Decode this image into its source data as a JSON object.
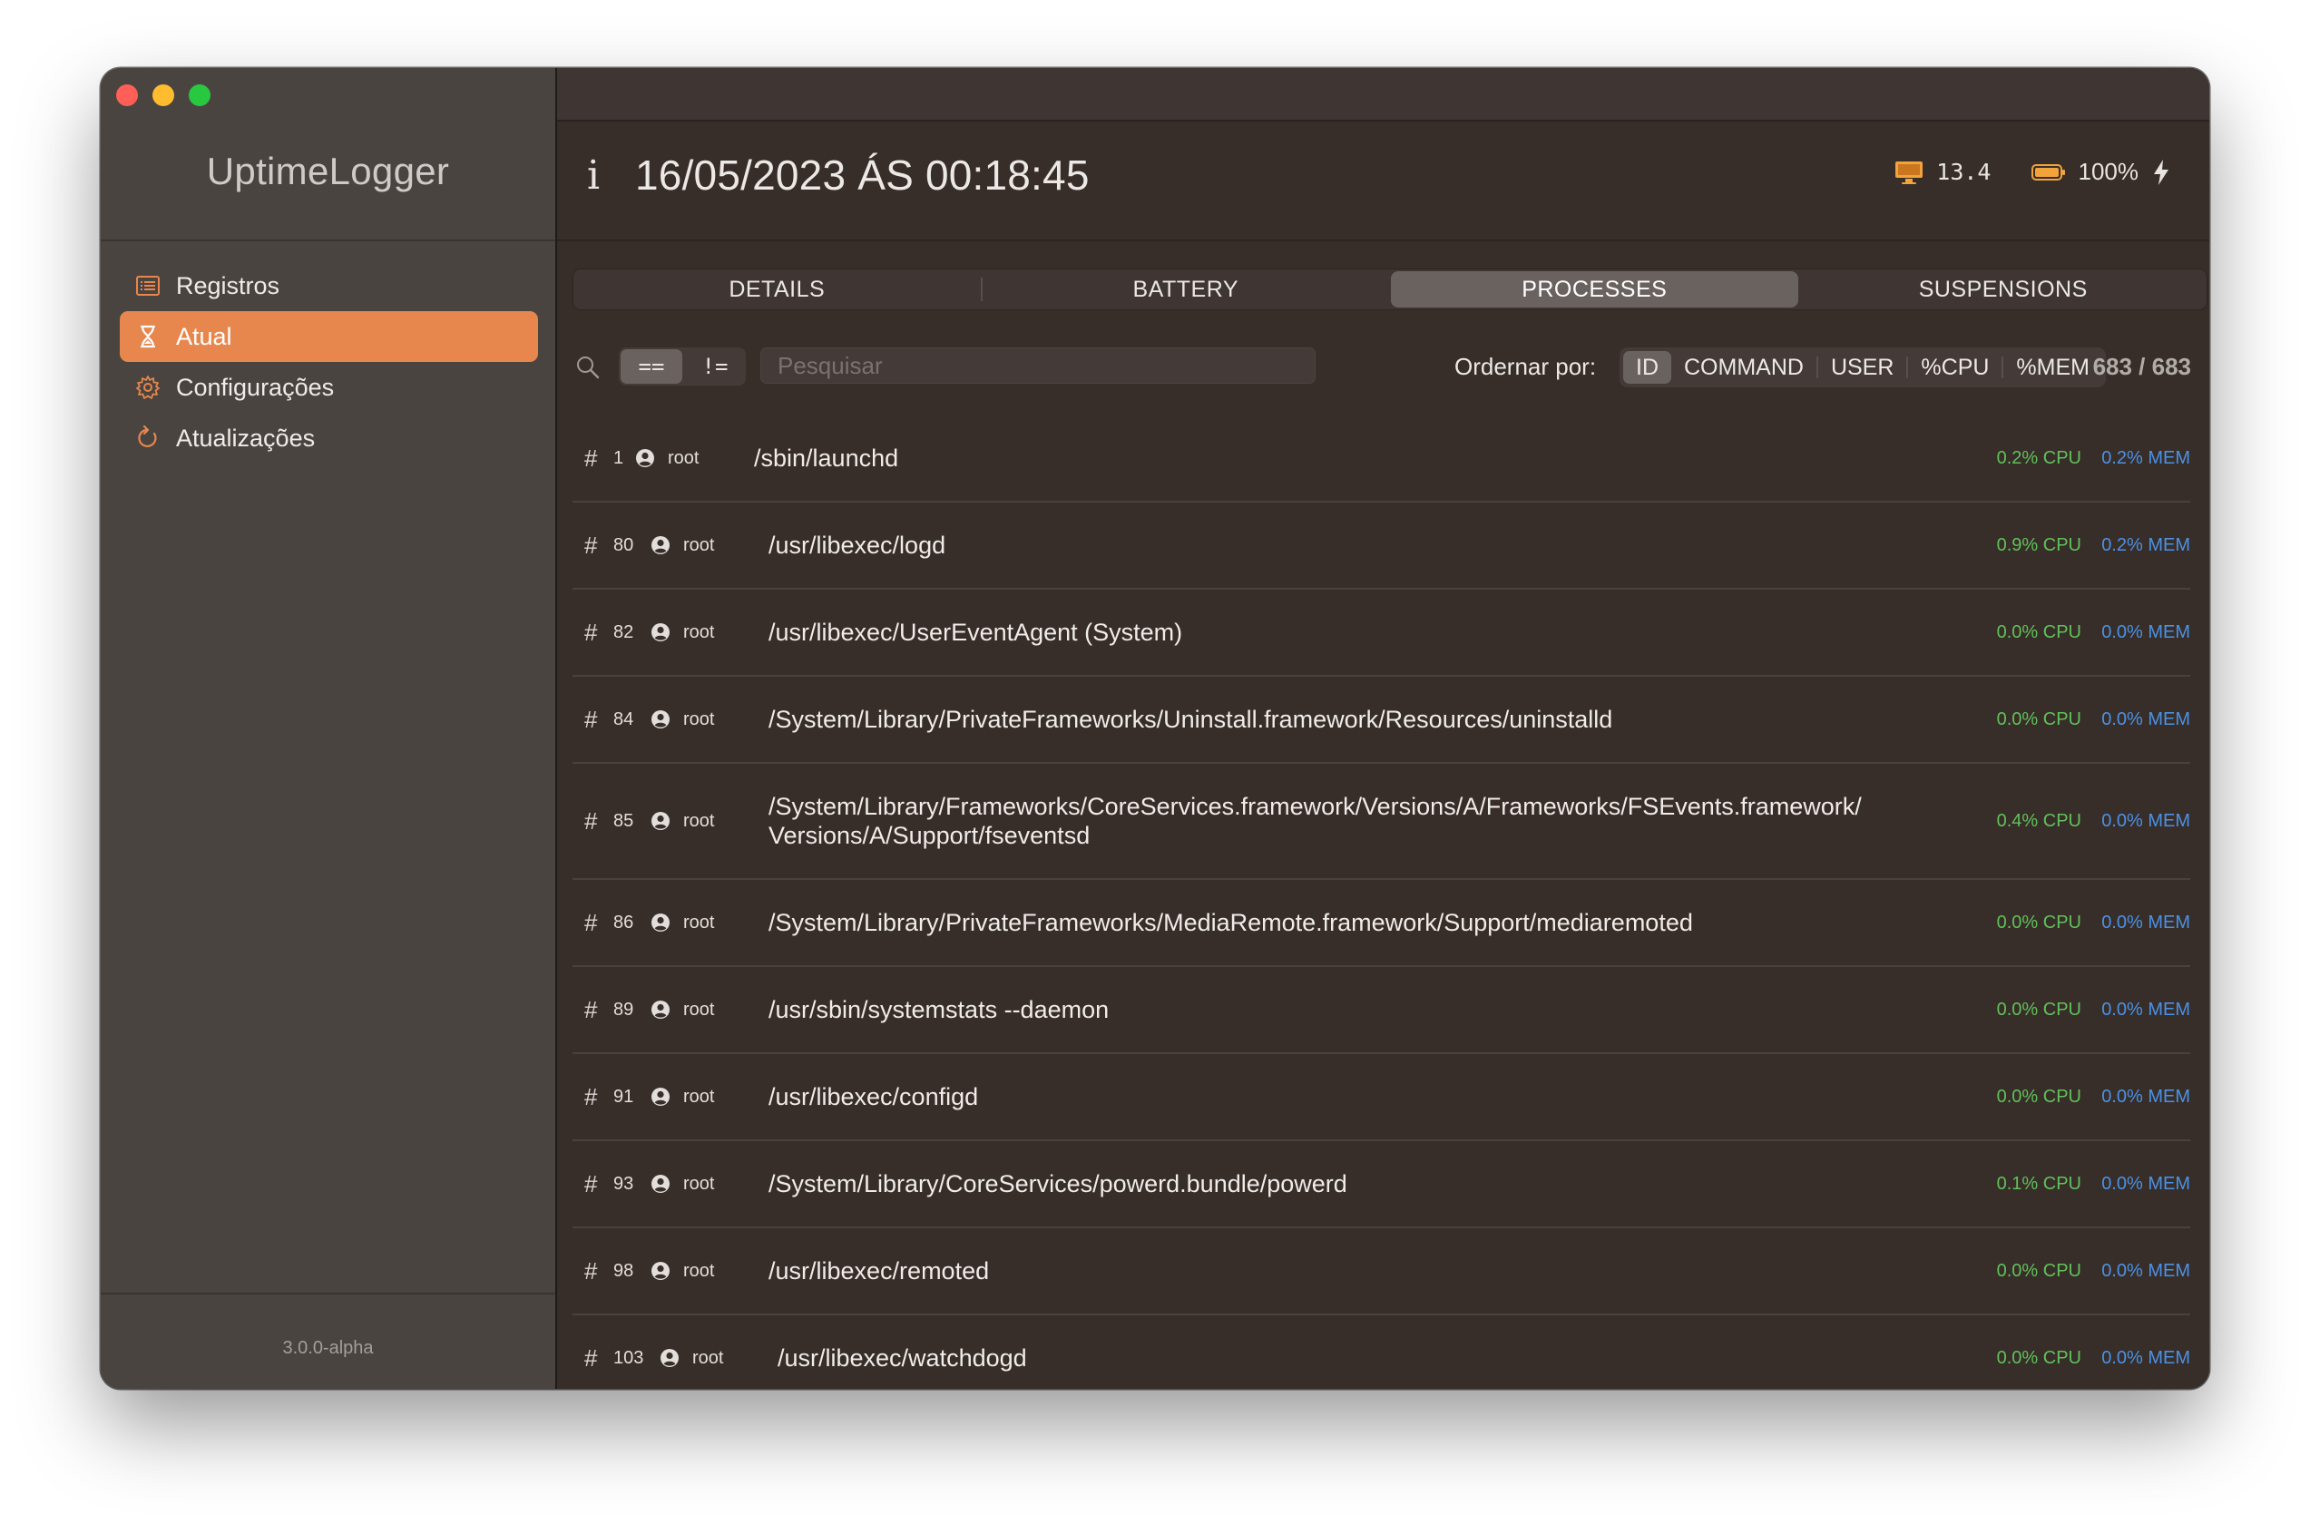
{
  "app": {
    "name": "UptimeLogger",
    "version": "3.0.0-alpha"
  },
  "sidebar": {
    "items": [
      {
        "label": "Registros",
        "icon": "list-icon",
        "active": false
      },
      {
        "label": "Atual",
        "icon": "hourglass-icon",
        "active": true
      },
      {
        "label": "Configurações",
        "icon": "gear-icon",
        "active": false
      },
      {
        "label": "Atualizações",
        "icon": "refresh-icon",
        "active": false
      }
    ]
  },
  "header": {
    "info_glyph": "i",
    "timestamp": "16/05/2023 ÁS 00:18:45",
    "os_version": "13.4",
    "battery": "100%",
    "charging": true
  },
  "tabs": [
    {
      "label": "DETAILS",
      "active": false
    },
    {
      "label": "BATTERY",
      "active": false
    },
    {
      "label": "PROCESSES",
      "active": true
    },
    {
      "label": "SUSPENSIONS",
      "active": false
    }
  ],
  "filter": {
    "operators": [
      {
        "label": "==",
        "active": true
      },
      {
        "label": "!=",
        "active": false
      }
    ],
    "search_placeholder": "Pesquisar",
    "search_value": "",
    "sort_label": "Ordernar por:",
    "sort_options": [
      {
        "label": "ID",
        "active": true
      },
      {
        "label": "COMMAND",
        "active": false
      },
      {
        "label": "USER",
        "active": false
      },
      {
        "label": "%CPU",
        "active": false
      },
      {
        "label": "%MEM",
        "active": false
      }
    ],
    "count": "683 / 683"
  },
  "processes": [
    {
      "id": "1",
      "user": "root",
      "command": "/sbin/launchd",
      "cpu": "0.2% CPU",
      "mem": "0.2% MEM"
    },
    {
      "id": "80",
      "user": "root",
      "command": "/usr/libexec/logd",
      "cpu": "0.9% CPU",
      "mem": "0.2% MEM"
    },
    {
      "id": "82",
      "user": "root",
      "command": "/usr/libexec/UserEventAgent (System)",
      "cpu": "0.0% CPU",
      "mem": "0.0% MEM"
    },
    {
      "id": "84",
      "user": "root",
      "command": "/System/Library/PrivateFrameworks/Uninstall.framework/Resources/uninstalld",
      "cpu": "0.0% CPU",
      "mem": "0.0% MEM"
    },
    {
      "id": "85",
      "user": "root",
      "command": "/System/Library/Frameworks/CoreServices.framework/Versions/A/Frameworks/FSEvents.framework/\nVersions/A/Support/fseventsd",
      "cpu": "0.4% CPU",
      "mem": "0.0% MEM"
    },
    {
      "id": "86",
      "user": "root",
      "command": "/System/Library/PrivateFrameworks/MediaRemote.framework/Support/mediaremoted",
      "cpu": "0.0% CPU",
      "mem": "0.0% MEM"
    },
    {
      "id": "89",
      "user": "root",
      "command": "/usr/sbin/systemstats --daemon",
      "cpu": "0.0% CPU",
      "mem": "0.0% MEM"
    },
    {
      "id": "91",
      "user": "root",
      "command": "/usr/libexec/configd",
      "cpu": "0.0% CPU",
      "mem": "0.0% MEM"
    },
    {
      "id": "93",
      "user": "root",
      "command": "/System/Library/CoreServices/powerd.bundle/powerd",
      "cpu": "0.1% CPU",
      "mem": "0.0% MEM"
    },
    {
      "id": "98",
      "user": "root",
      "command": "/usr/libexec/remoted",
      "cpu": "0.0% CPU",
      "mem": "0.0% MEM"
    },
    {
      "id": "103",
      "user": "root",
      "command": "/usr/libexec/watchdogd",
      "cpu": "0.0% CPU",
      "mem": "0.0% MEM"
    }
  ],
  "colors": {
    "accent": "#e7874d",
    "cpu": "#61c15a",
    "mem": "#4a92e6",
    "battery": "#f2a33a"
  }
}
